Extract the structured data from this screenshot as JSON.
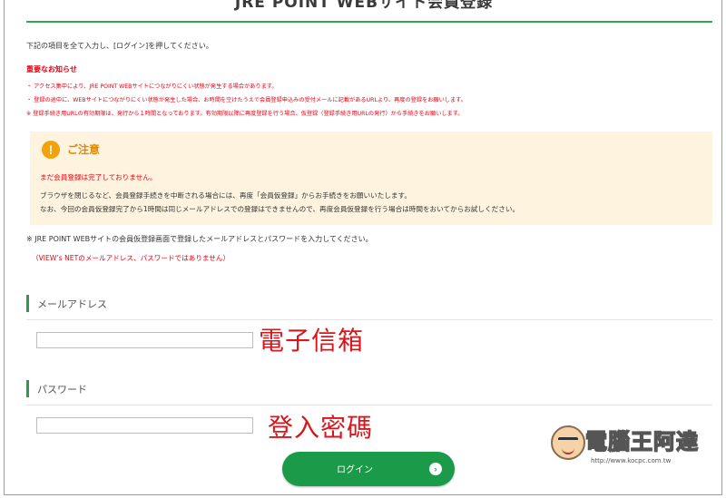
{
  "page": {
    "title": "JRE POINT WEBサイト会員登録",
    "intro": "下記の項目を全て入力し、[ログイン]を押してください。"
  },
  "notice": {
    "heading": "重要なお知らせ",
    "lines": [
      "・ アクセス集中により、JRE POINT WEBサイトにつながりにくい状態が発生する場合があります。",
      "・ 登録の途中に、WEBサイトにつながりにくい状態が発生した場合、お時間を空けたうえで会員登録申込みの受付メールに記載があるURLより、再度の登録をお願いします。",
      "※ 登録手続き用URLの有効期限は、発行から１時間となっております。有効期限以降に再度登録を行う場合、仮登録（登録手続き用URLの発行）から手続きをお願いします。"
    ]
  },
  "caution": {
    "icon": "exclamation-icon",
    "title": "ご注意",
    "red_line": "まだ会員登録は完了しておりません。",
    "lines": [
      "ブラウザを閉じるなど、会員登録手続きを中断される場合には、再度「会員仮登録」からお手続きをお願いいたします。",
      "なお、今回の会員仮登録完了から1時間は同じメールアドレスでの登録はできませんので、再度会員仮登録を行う場合は時間をおいてからお試しください。"
    ]
  },
  "note": {
    "text": "※ JRE POINT WEBサイトの会員仮登録画面で登録したメールアドレスとパスワードを入力してください。",
    "red": "（VIEW’s NETのメールアドレス、パスワードではありません）"
  },
  "form": {
    "email": {
      "label": "メールアドレス",
      "value": "",
      "annotation": "電子信箱"
    },
    "password": {
      "label": "パスワード",
      "value": "",
      "annotation": "登入密碼"
    },
    "login_button": {
      "label": "ログイン",
      "icon": "chevron-right-icon"
    }
  },
  "watermark": {
    "text": "電腦王阿達",
    "url": "http://www.kocpc.com.tw"
  },
  "colors": {
    "accent_green": "#1b9a4a",
    "alert_red": "#e60012",
    "caution_bg": "#fdf3de",
    "caution_orange": "#f2a20c"
  }
}
